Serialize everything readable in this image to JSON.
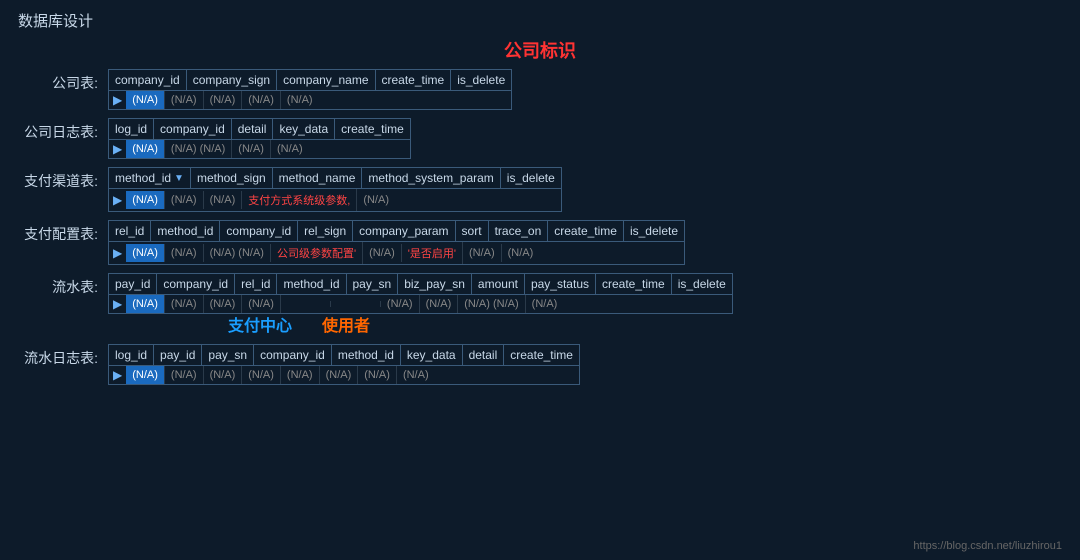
{
  "pageTitle": "数据库设计",
  "centerLabel": "公司标识",
  "watermark": "https://blog.csdn.net/liuzhirou1",
  "tables": [
    {
      "label": "公司表:",
      "columns": [
        "company_id",
        "company_sign",
        "company_name",
        "create_time",
        "is_delete"
      ],
      "rows": [
        [
          "(N/A)",
          "(N/A)",
          "(N/A)",
          "(N/A)",
          "(N/A)"
        ]
      ],
      "highlightCol": 0,
      "hasPk": false
    },
    {
      "label": "公司日志表:",
      "columns": [
        "log_id",
        "company_id",
        "detail",
        "key_data",
        "create_time"
      ],
      "rows": [
        [
          "(N/A)",
          "(N/A)",
          "(N/A)",
          "(N/A)",
          "(N/A)"
        ]
      ],
      "highlightCol": 0,
      "hasPk": false
    },
    {
      "label": "支付渠道表:",
      "columns": [
        "method_id",
        "method_sign",
        "method_name",
        "method_system_param",
        "is_delete"
      ],
      "rows": [
        [
          "(N/A)",
          "(N/A)",
          "(N/A)",
          "支付方式系统级参数,",
          "(N/A)"
        ]
      ],
      "highlightCol": 0,
      "hasPk": true,
      "redCols": [
        3
      ]
    },
    {
      "label": "支付配置表:",
      "columns": [
        "rel_id",
        "method_id",
        "company_id",
        "rel_sign",
        "company_param",
        "sort",
        "trace_on",
        "create_time",
        "is_delete"
      ],
      "rows": [
        [
          "(N/A)",
          "(N/A)",
          "(N/A)",
          "(N/A)",
          "公司级参数配置'",
          "(N/A)",
          "'是否启用'",
          "(N/A)",
          "(N/A)"
        ]
      ],
      "highlightCol": 0,
      "hasPk": false,
      "redCols": [
        4,
        6
      ]
    },
    {
      "label": "流水表:",
      "columns": [
        "pay_id",
        "company_id",
        "rel_id",
        "method_id",
        "pay_sn",
        "biz_pay_sn",
        "amount",
        "pay_status",
        "create_time",
        "is_delete"
      ],
      "rows": [
        [
          "(N/A)",
          "(N/A)",
          "(N/A)",
          "(N/A)",
          "",
          "",
          "(N/A)",
          "(N/A)",
          "(N/A)",
          "(N/A)"
        ]
      ],
      "highlightCol": 0,
      "hasPk": false,
      "specialRow": true
    },
    {
      "label": "流水日志表:",
      "columns": [
        "log_id",
        "pay_id",
        "pay_sn",
        "company_id",
        "method_id",
        "key_data",
        "detail",
        "create_time"
      ],
      "rows": [
        [
          "(N/A)",
          "(N/A)",
          "(N/A)",
          "(N/A)",
          "(N/A)",
          "(N/A)",
          "(N/A)",
          "(N/A)"
        ]
      ],
      "highlightCol": 0,
      "hasPk": false
    }
  ]
}
